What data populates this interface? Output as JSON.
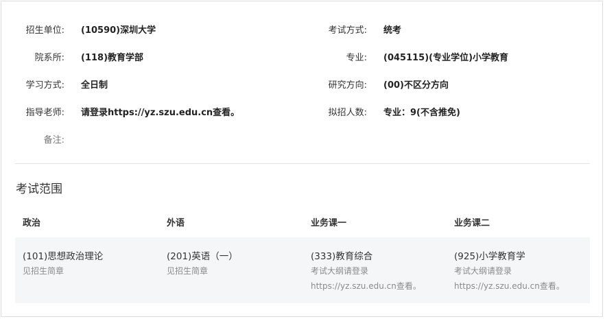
{
  "info": {
    "left": [
      {
        "label": "招生单位:",
        "value": "(10590)深圳大学"
      },
      {
        "label": "院系所:",
        "value": "(118)教育学部"
      },
      {
        "label": "学习方式:",
        "value": "全日制"
      },
      {
        "label": "指导老师:",
        "value": "请登录https://yz.szu.edu.cn查看。"
      },
      {
        "label": "备注:",
        "value": ""
      }
    ],
    "right": [
      {
        "label": "考试方式:",
        "value": "统考"
      },
      {
        "label": "专业:",
        "value": "(045115)(专业学位)小学教育"
      },
      {
        "label": "研究方向:",
        "value": "(00)不区分方向"
      },
      {
        "label": "拟招人数:",
        "value": "专业：9(不含推免)"
      }
    ]
  },
  "exam_scope": {
    "title": "考试范围",
    "headers": [
      "政治",
      "外语",
      "业务课一",
      "业务课二"
    ],
    "cells": [
      {
        "subject": "(101)思想政治理论",
        "notes": [
          "见招生简章"
        ]
      },
      {
        "subject": "(201)英语（一）",
        "notes": [
          "见招生简章"
        ]
      },
      {
        "subject": "(333)教育综合",
        "notes": [
          "考试大纲请登录",
          "https://yz.szu.edu.cn查看。"
        ]
      },
      {
        "subject": "(925)小学教育学",
        "notes": [
          "考试大纲请登录",
          "https://yz.szu.edu.cn查看。"
        ]
      }
    ]
  }
}
